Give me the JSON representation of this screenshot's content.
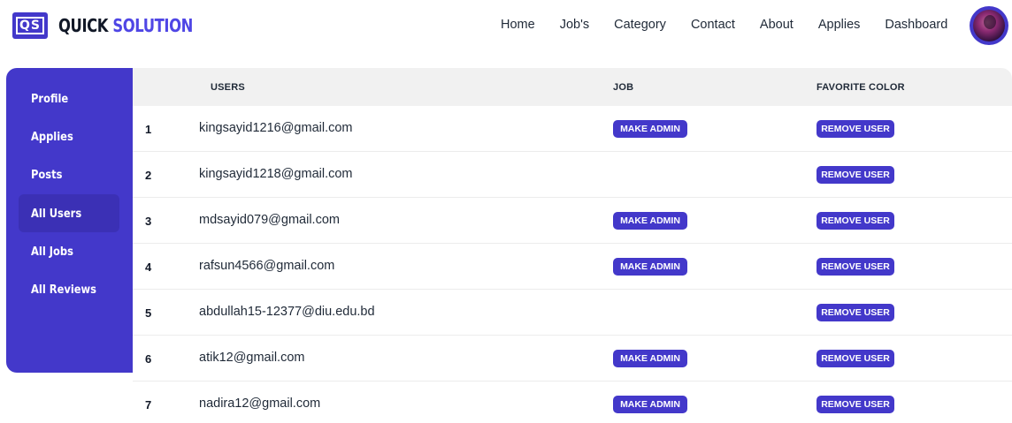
{
  "logo": {
    "mark": "QS",
    "quick": "QUICK",
    "solution": "SOLUTION"
  },
  "nav": {
    "items": [
      "Home",
      "Job's",
      "Category",
      "Contact",
      "About",
      "Applies",
      "Dashboard"
    ]
  },
  "sidebar": {
    "items": [
      {
        "label": "Profile",
        "active": false
      },
      {
        "label": "Applies",
        "active": false
      },
      {
        "label": "Posts",
        "active": false
      },
      {
        "label": "All Users",
        "active": true
      },
      {
        "label": "All Jobs",
        "active": false
      },
      {
        "label": "All Reviews",
        "active": false
      }
    ]
  },
  "table": {
    "headers": {
      "users": "USERS",
      "job": "JOB",
      "favorite_color": "FAVORITE COLOR"
    },
    "make_admin_label": "MAKE ADMIN",
    "remove_user_label": "REMOVE USER",
    "rows": [
      {
        "num": "1",
        "email": "kingsayid1216@gmail.com",
        "make_admin": true
      },
      {
        "num": "2",
        "email": "kingsayid1218@gmail.com",
        "make_admin": false
      },
      {
        "num": "3",
        "email": "mdsayid079@gmail.com",
        "make_admin": true
      },
      {
        "num": "4",
        "email": "rafsun4566@gmail.com",
        "make_admin": true
      },
      {
        "num": "5",
        "email": "abdullah15-12377@diu.edu.bd",
        "make_admin": false
      },
      {
        "num": "6",
        "email": "atik12@gmail.com",
        "make_admin": true
      },
      {
        "num": "7",
        "email": "nadira12@gmail.com",
        "make_admin": true
      }
    ]
  },
  "colors": {
    "accent": "#4338ca",
    "logo_solution": "#4f46e5",
    "header_bg": "#f1f1f1"
  }
}
